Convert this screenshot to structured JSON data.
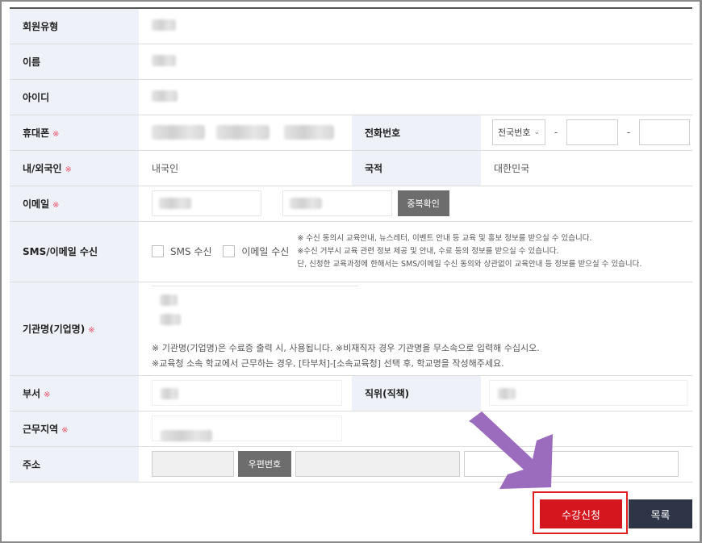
{
  "labels": {
    "member_type": "회원유형",
    "name": "이름",
    "user_id": "아이디",
    "mobile": "휴대폰",
    "phone": "전화번호",
    "nationality_type": "내/외국인",
    "country": "국적",
    "email": "이메일",
    "sms_email": "SMS/이메일 수신",
    "org_name": "기관명(기업명)",
    "department": "부서",
    "position": "직위(직책)",
    "work_region": "근무지역",
    "address": "주소"
  },
  "required_mark": "※",
  "values": {
    "nationality_type": "내국인",
    "country": "대한민국"
  },
  "phone": {
    "area_select": "전국번호",
    "dash": "-"
  },
  "buttons": {
    "dup_check": "중복확인",
    "zipcode": "우편번호",
    "apply": "수강신청",
    "list": "목록"
  },
  "consent": {
    "sms_label": "SMS 수신",
    "email_label": "이메일 수신",
    "notes": [
      "※ 수신 동의시 교육안내, 뉴스레터, 이벤트 안내 등 교육 및 홍보 정보를 받으실 수 있습니다.",
      "※수신 거부시 교육 관련 정보 제공 및 안내, 수료 등의 정보를 받으실 수 있습니다.",
      "단, 신청한 교육과정에 한해서는 SMS/이메일 수신 동의와 상관없이 교육안내 등 정보를 받으실 수 있습니다."
    ]
  },
  "org_notes": [
    "※ 기관명(기업명)은 수료증 출력 시, 사용됩니다. ※비재직자 경우 기관명을 무소속으로 입력해 수십시오.",
    "※교육청 소속 학교에서 근무하는 경우, [타부처]-[소속교육청] 선택 후, 학교명을 작성해주세요."
  ],
  "colors": {
    "label_bg": "#eef2f8",
    "apply": "#d4161f",
    "list": "#2d3547",
    "arrow": "#9b6bbd",
    "required": "#e8506a"
  },
  "icons": {
    "select_arrow": "chevron-down-icon",
    "pointer": "arrow-down-right-icon"
  }
}
